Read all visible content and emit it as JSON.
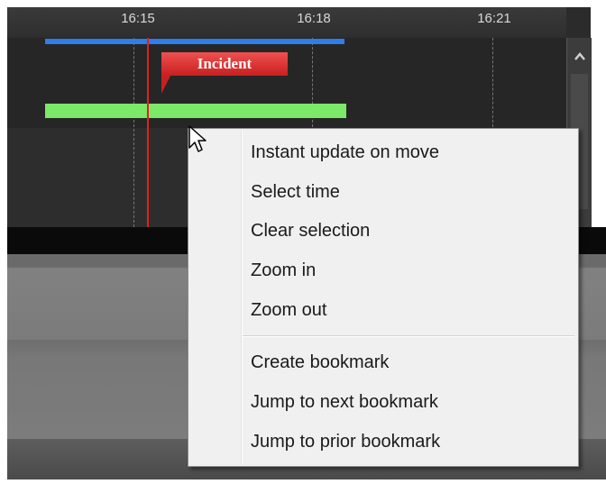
{
  "timeline": {
    "ticks": [
      "16:15",
      "16:18",
      "16:21"
    ],
    "bookmark": {
      "label": "Incident",
      "color": "#e03838"
    },
    "colors": {
      "selection_bar": "#2e7de8",
      "recording_bar": "#7be868",
      "playhead": "#e02020"
    },
    "scroll_up_icon": "chevron-up-icon"
  },
  "context_menu": {
    "items": [
      {
        "label": "Instant update on move"
      },
      {
        "label": "Select time"
      },
      {
        "label": "Clear selection"
      },
      {
        "label": "Zoom in"
      },
      {
        "label": "Zoom out"
      },
      {
        "label": "Create bookmark"
      },
      {
        "label": "Jump to next bookmark"
      },
      {
        "label": "Jump to prior bookmark"
      }
    ]
  },
  "cursor": {
    "icon": "arrow-pointer-icon"
  }
}
